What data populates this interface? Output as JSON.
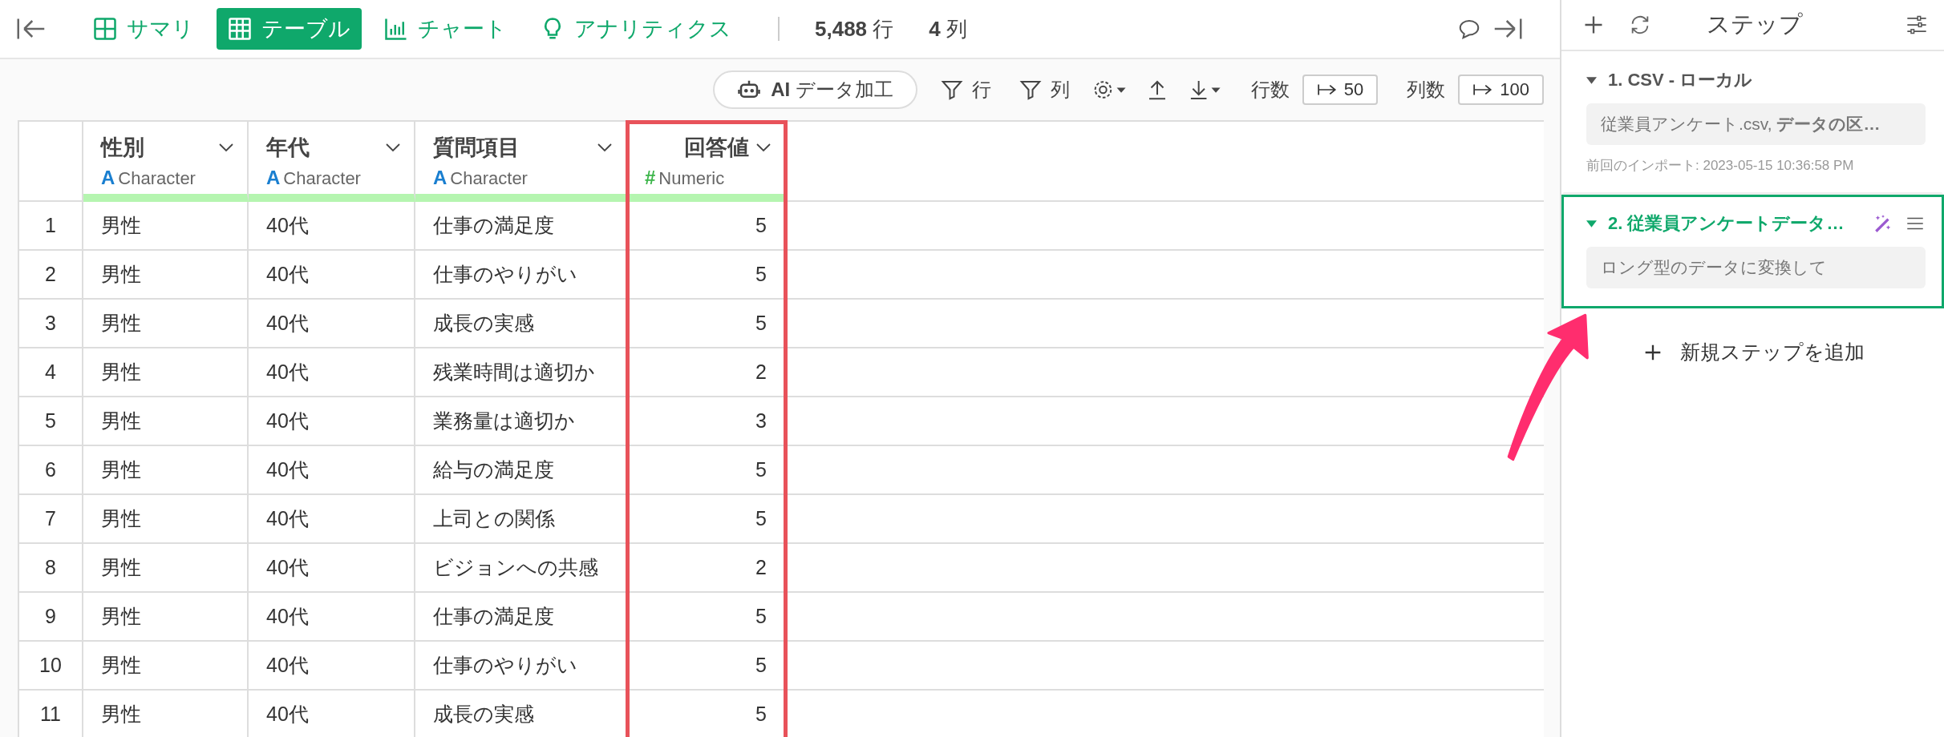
{
  "topbar": {
    "tabs": [
      {
        "label": "サマリ",
        "kind": "summary",
        "selected": false
      },
      {
        "label": "テーブル",
        "kind": "table",
        "selected": true
      },
      {
        "label": "チャート",
        "kind": "chart",
        "selected": false
      },
      {
        "label": "アナリティクス",
        "kind": "analytics",
        "selected": false
      }
    ],
    "row_count": "5,488",
    "row_unit": "行",
    "col_count": "4",
    "col_unit": "列"
  },
  "actions": {
    "ai_button": "**AI** データ加工",
    "row_filter": "行",
    "col_filter": "列",
    "rows_label": "行数",
    "rows_value": "50",
    "cols_label": "列数",
    "cols_value": "100"
  },
  "table": {
    "columns": [
      {
        "name": "性別",
        "kind": "character",
        "type_icon": "A",
        "type": "Character",
        "highlighted": false
      },
      {
        "name": "年代",
        "kind": "character",
        "type_icon": "A",
        "type": "Character",
        "highlighted": false
      },
      {
        "name": "質問項目",
        "kind": "character",
        "type_icon": "A",
        "type": "Character",
        "highlighted": false
      },
      {
        "name": "回答値",
        "kind": "numeric",
        "type_icon": "#",
        "type": "Numeric",
        "highlighted": true
      }
    ],
    "rows": [
      {
        "num": "1",
        "cells": [
          "男性",
          "40代",
          "仕事の満足度",
          "5"
        ]
      },
      {
        "num": "2",
        "cells": [
          "男性",
          "40代",
          "仕事のやりがい",
          "5"
        ]
      },
      {
        "num": "3",
        "cells": [
          "男性",
          "40代",
          "成長の実感",
          "5"
        ]
      },
      {
        "num": "4",
        "cells": [
          "男性",
          "40代",
          "残業時間は適切か",
          "2"
        ]
      },
      {
        "num": "5",
        "cells": [
          "男性",
          "40代",
          "業務量は適切か",
          "3"
        ]
      },
      {
        "num": "6",
        "cells": [
          "男性",
          "40代",
          "給与の満足度",
          "5"
        ]
      },
      {
        "num": "7",
        "cells": [
          "男性",
          "40代",
          "上司との関係",
          "5"
        ]
      },
      {
        "num": "8",
        "cells": [
          "男性",
          "40代",
          "ビジョンへの共感",
          "2"
        ]
      },
      {
        "num": "9",
        "cells": [
          "男性",
          "40代",
          "仕事の満足度",
          "5"
        ]
      },
      {
        "num": "10",
        "cells": [
          "男性",
          "40代",
          "仕事のやりがい",
          "5"
        ]
      },
      {
        "num": "11",
        "cells": [
          "男性",
          "40代",
          "成長の実感",
          "5"
        ]
      }
    ]
  },
  "steps_panel": {
    "title": "ステップ",
    "steps": [
      {
        "title": "1. CSV - ローカル",
        "description": "従業員アンケート.csv, **データの区…**",
        "note": "前回のインポート: 2023-05-15 10:36:58 PM",
        "selected": false
      },
      {
        "title": "2. 従業員アンケートデータ…",
        "description": "ロング型のデータに変換して",
        "selected": true
      }
    ],
    "add_step": "新規ステップを追加"
  }
}
